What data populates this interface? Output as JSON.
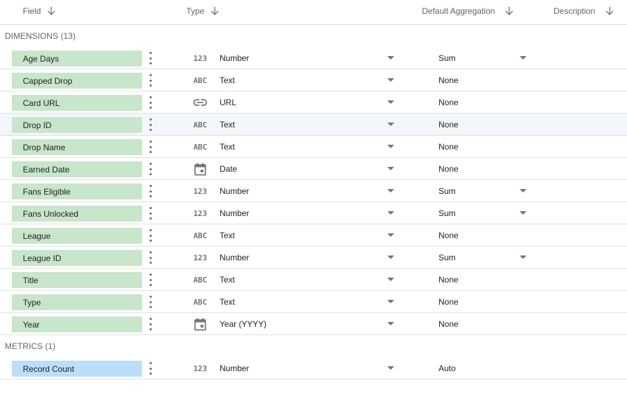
{
  "header": {
    "field": "Field",
    "type": "Type",
    "aggregation": "Default Aggregation",
    "description": "Description"
  },
  "dimensions_label": "DIMENSIONS (13)",
  "metrics_label": "METRICS (1)",
  "icon_labels": {
    "number": "123",
    "text": "ABC"
  },
  "colors": {
    "dimension": "#c8e6c9",
    "metric": "#bbdefb",
    "highlight_row": "#f2f7fb"
  },
  "dimensions": [
    {
      "name": "Age Days",
      "icon": "number",
      "type": "Number",
      "agg": "Sum",
      "agg_dropdown": true
    },
    {
      "name": "Capped Drop",
      "icon": "text",
      "type": "Text",
      "agg": "None",
      "agg_dropdown": false
    },
    {
      "name": "Card URL",
      "icon": "link",
      "type": "URL",
      "agg": "None",
      "agg_dropdown": false
    },
    {
      "name": "Drop ID",
      "icon": "text",
      "type": "Text",
      "agg": "None",
      "agg_dropdown": false,
      "highlighted": true
    },
    {
      "name": "Drop Name",
      "icon": "text",
      "type": "Text",
      "agg": "None",
      "agg_dropdown": false
    },
    {
      "name": "Earned Date",
      "icon": "calendar",
      "type": "Date",
      "agg": "None",
      "agg_dropdown": false
    },
    {
      "name": "Fans Eligible",
      "icon": "number",
      "type": "Number",
      "agg": "Sum",
      "agg_dropdown": true
    },
    {
      "name": "Fans Unlocked",
      "icon": "number",
      "type": "Number",
      "agg": "Sum",
      "agg_dropdown": true
    },
    {
      "name": "League",
      "icon": "text",
      "type": "Text",
      "agg": "None",
      "agg_dropdown": false
    },
    {
      "name": "League ID",
      "icon": "number",
      "type": "Number",
      "agg": "Sum",
      "agg_dropdown": true
    },
    {
      "name": "Title",
      "icon": "text",
      "type": "Text",
      "agg": "None",
      "agg_dropdown": false
    },
    {
      "name": "Type",
      "icon": "text",
      "type": "Text",
      "agg": "None",
      "agg_dropdown": false
    },
    {
      "name": "Year",
      "icon": "calendar",
      "type": "Year (YYYY)",
      "agg": "None",
      "agg_dropdown": false
    }
  ],
  "metrics": [
    {
      "name": "Record Count",
      "icon": "number",
      "type": "Number",
      "agg": "Auto",
      "agg_dropdown": false
    }
  ]
}
